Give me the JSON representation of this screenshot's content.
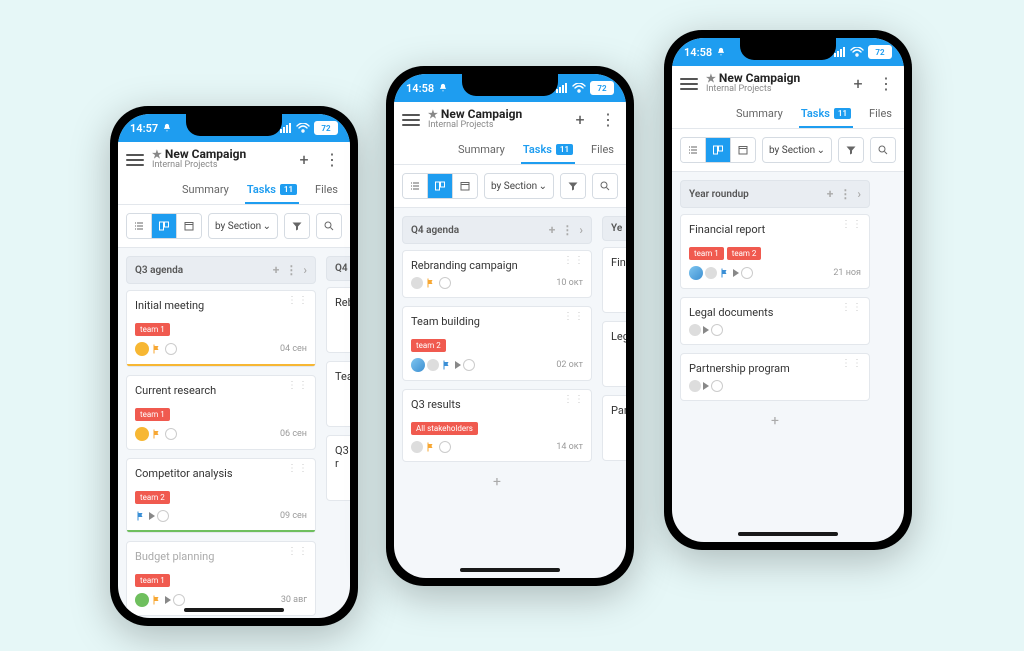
{
  "colors": {
    "accent": "#1e9df0",
    "bg": "#e6f7f7",
    "chip": "#f05a4f",
    "flag": "#f7a733"
  },
  "statusbars": [
    {
      "time": "14:57",
      "battery": "72"
    },
    {
      "time": "14:58",
      "battery": "72"
    },
    {
      "time": "14:58",
      "battery": "72"
    }
  ],
  "header": {
    "title": "New Campaign",
    "subtitle": "Internal Projects"
  },
  "tabs": {
    "summary": "Summary",
    "tasks": "Tasks",
    "tasks_count": "11",
    "files": "Files"
  },
  "toolbar": {
    "sort": "by Section"
  },
  "phones": [
    {
      "col_title": "Q3 agenda",
      "peek": "Q4",
      "cards": [
        {
          "title": "Initial meeting",
          "chips": [
            "team 1"
          ],
          "date": "04 сен",
          "tick": true,
          "flag": "orange",
          "underline": "orange"
        },
        {
          "title": "Current research",
          "chips": [
            "team 1"
          ],
          "date": "06 сен",
          "tick": true,
          "flag": "orange",
          "underline": null
        },
        {
          "title": "Competitor analysis",
          "chips": [
            "team 2"
          ],
          "date": "09 сен",
          "tick": false,
          "flag": "blue",
          "underline": "green",
          "play": true
        },
        {
          "title": "Budget planning",
          "chips": [
            "team 1"
          ],
          "date": "30 авг",
          "tick": false,
          "flag": "orange",
          "muted": true,
          "ok": true,
          "play": true
        }
      ],
      "peekcards": [
        "Rebr",
        "Tea",
        "Q3 r"
      ]
    },
    {
      "col_title": "Q4 agenda",
      "peek": "Ye",
      "cards": [
        {
          "title": "Rebranding campaign",
          "chips": [],
          "date": "10 окт",
          "flag": "orange",
          "dot": true
        },
        {
          "title": "Team building",
          "chips": [
            "team 2"
          ],
          "date": "02 окт",
          "flag": "blue",
          "av": true,
          "dot": true,
          "play": true
        },
        {
          "title": "Q3 results",
          "chips": [
            "All stakeholders"
          ],
          "date": "14 окт",
          "flag": "orange",
          "dot": true
        }
      ],
      "peekcards": [
        "Fina",
        "Lega",
        "Part"
      ]
    },
    {
      "col_title": "Year roundup",
      "peek": null,
      "cards": [
        {
          "title": "Financial report",
          "chips": [
            "team 1",
            "team 2"
          ],
          "date": "21 ноя",
          "flag": "blue",
          "av": true,
          "dot": true,
          "play": true
        },
        {
          "title": "Legal documents",
          "chips": [],
          "date": "",
          "dot": true,
          "play": true
        },
        {
          "title": "Partnership program",
          "chips": [],
          "date": "",
          "dot": true,
          "play": true
        }
      ]
    }
  ]
}
